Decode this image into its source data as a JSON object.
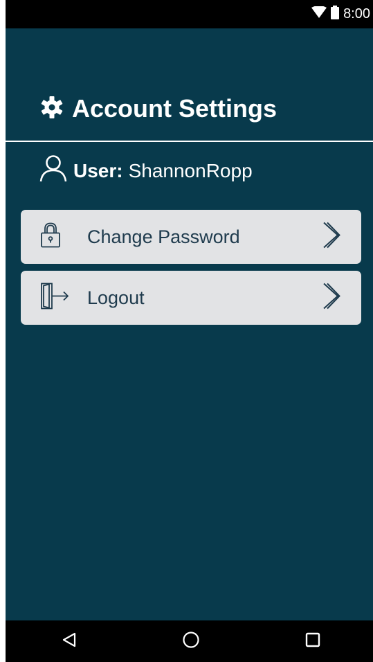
{
  "status_bar": {
    "time": "8:00",
    "icons": [
      "wifi-icon",
      "battery-icon"
    ]
  },
  "header": {
    "title": "Account Settings",
    "icon": "gear-icon"
  },
  "user": {
    "icon": "person-icon",
    "label": "User:",
    "name": "ShannonRopp"
  },
  "menu": [
    {
      "label": "Change Password",
      "icon": "lock-icon",
      "chevron": "chevron-right-icon"
    },
    {
      "label": "Logout",
      "icon": "logout-door-icon",
      "chevron": "chevron-right-icon"
    }
  ],
  "nav_bar": {
    "buttons": [
      "back-triangle-icon",
      "home-circle-icon",
      "recents-square-icon"
    ]
  },
  "colors": {
    "background": "#083a4c",
    "menu_item_bg": "#e2e3e5",
    "menu_text": "#1f3b4d",
    "system_bar": "#000000"
  }
}
